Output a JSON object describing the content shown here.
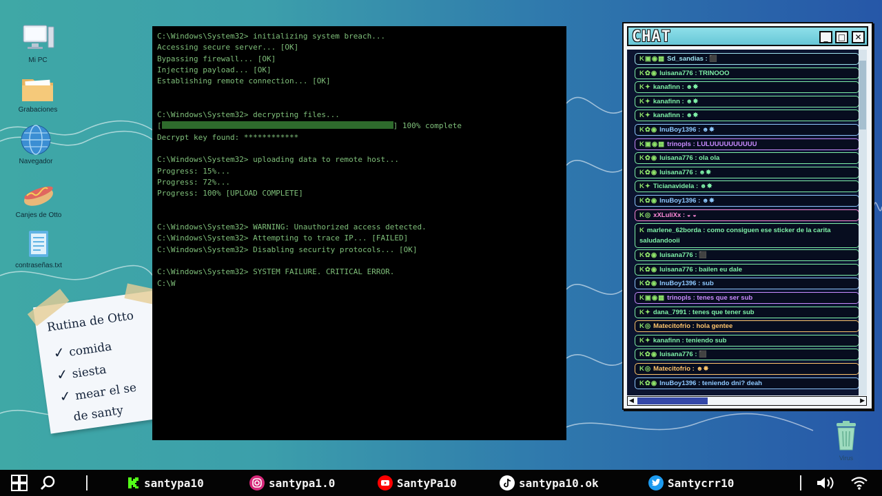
{
  "desktop": {
    "icons": [
      {
        "label": "Mi PC",
        "icon": "computer-icon"
      },
      {
        "label": "Grabaciones",
        "icon": "folder-icon"
      },
      {
        "label": "Navegador",
        "icon": "globe-icon"
      },
      {
        "label": "Canjes de Otto",
        "icon": "hotdog-icon"
      },
      {
        "label": "contraseñas.txt",
        "icon": "text-file-icon"
      }
    ],
    "trash": {
      "label": "Virus",
      "icon": "trash-icon"
    }
  },
  "note": {
    "title": "Rutina de Otto",
    "items": [
      "comida",
      "siesta",
      "mear el se"
    ],
    "footer": "de santy"
  },
  "terminal": {
    "lines": [
      "C:\\Windows\\System32> initializing system breach...",
      "Accessing secure server... [OK]",
      "Bypassing firewall... [OK]",
      "Injecting payload... [OK]",
      "Establishing remote connection... [OK]",
      "",
      "",
      "C:\\Windows\\System32> decrypting files...",
      "",
      "Decrypt key found: ************",
      "",
      "C:\\Windows\\System32> uploading data to remote host...",
      "Progress: 15%...",
      "Progress: 72%...",
      "Progress: 100% [UPLOAD COMPLETE]",
      "",
      "",
      "C:\\Windows\\System32> WARNING: Unauthorized access detected.",
      "C:\\Windows\\System32> Attempting to trace IP... [FAILED]",
      "C:\\Windows\\System32> Disabling security protocols... [OK]",
      "",
      "C:\\Windows\\System32> SYSTEM FAILURE. CRITICAL ERROR.",
      "C:\\W"
    ],
    "progress_open": "[",
    "progress_close": "] 100% complete",
    "progress_fraction": 1.0
  },
  "chat": {
    "title": "CHAT",
    "buttons": {
      "minimize": "_",
      "maximize": "□",
      "close": "✕"
    },
    "messages": [
      {
        "user": "Sd_sandias",
        "text": " : ⬛",
        "color": "#9fe3f0",
        "badges": "K▣◉▦"
      },
      {
        "user": "luisana776",
        "text": " : TRINOOO",
        "color": "#7ff2a8",
        "badges": "K✿◉"
      },
      {
        "user": "kanafinn",
        "text": " : ☻✸",
        "color": "#7ff2a8",
        "badges": "K✦"
      },
      {
        "user": "kanafinn",
        "text": " : ☻✸",
        "color": "#7ff2a8",
        "badges": "K✦"
      },
      {
        "user": "kanafinn",
        "text": " : ☻✸",
        "color": "#7ff2a8",
        "badges": "K✦"
      },
      {
        "user": "InuBoy1396",
        "text": " : ☻✸",
        "color": "#8ec8ff",
        "badges": "K✿◉"
      },
      {
        "user": "trinopls",
        "text": " : LULUUUUUUUUUU",
        "color": "#c98bff",
        "badges": "K▣◉▦"
      },
      {
        "user": "luisana776",
        "text": " : ola ola",
        "color": "#7ff2a8",
        "badges": "K✿◉"
      },
      {
        "user": "luisana776",
        "text": " : ☻✸",
        "color": "#7ff2a8",
        "badges": "K✿◉"
      },
      {
        "user": "Ticianavidela",
        "text": " : ☻✸",
        "color": "#7ff2a8",
        "badges": "K✦"
      },
      {
        "user": "InuBoy1396",
        "text": " : ☻✸",
        "color": "#8ec8ff",
        "badges": "K✿◉"
      },
      {
        "user": "xXLuliXx",
        "text": " : ◒ ◒",
        "color": "#ff8ad8",
        "badges": "K◎"
      },
      {
        "user": "marlene_62borda",
        "text": " : como consiguen ese sticker de la carita saludandooii",
        "color": "#7ff2a8",
        "badges": "K",
        "wrap": true
      },
      {
        "user": "luisana776",
        "text": " : ⬛",
        "color": "#7ff2a8",
        "badges": "K✿◉"
      },
      {
        "user": "luisana776",
        "text": " : bailen eu dale",
        "color": "#7ff2a8",
        "badges": "K✿◉"
      },
      {
        "user": "InuBoy1396",
        "text": " : sub",
        "color": "#8ec8ff",
        "badges": "K✿◉"
      },
      {
        "user": "trinopls",
        "text": " : tenes que ser sub",
        "color": "#c98bff",
        "badges": "K▣◉▦"
      },
      {
        "user": "dana_7991",
        "text": " : tenes que tener sub",
        "color": "#7ff2a8",
        "badges": "K✦"
      },
      {
        "user": "Matecitofrio",
        "text": " : hola gentee",
        "color": "#ffc46b",
        "badges": "K◎"
      },
      {
        "user": "kanafinn",
        "text": " : teniendo sub",
        "color": "#7ff2a8",
        "badges": "K✦"
      },
      {
        "user": "luisana776",
        "text": " : ⬛",
        "color": "#7ff2a8",
        "badges": "K✿◉"
      },
      {
        "user": "Matecitofrio",
        "text": " : ☻✸",
        "color": "#ffc46b",
        "badges": "K◎"
      },
      {
        "user": "InuBoy1396",
        "text": " : teniendo dni? deah",
        "color": "#8ec8ff",
        "badges": "K✿◉"
      }
    ]
  },
  "taskbar": {
    "socials": [
      {
        "icon": "kick-icon",
        "label": "santypa10",
        "color": "#53fc18"
      },
      {
        "icon": "instagram-icon",
        "label": "santypa1.0",
        "color": "#d6297a"
      },
      {
        "icon": "youtube-icon",
        "label": "SantyPa10",
        "color": "#ff0000"
      },
      {
        "icon": "tiktok-icon",
        "label": "santypa10.ok",
        "color": "#ffffff"
      },
      {
        "icon": "twitter-icon",
        "label": "Santycrr10",
        "color": "#1d9bf0"
      }
    ]
  }
}
